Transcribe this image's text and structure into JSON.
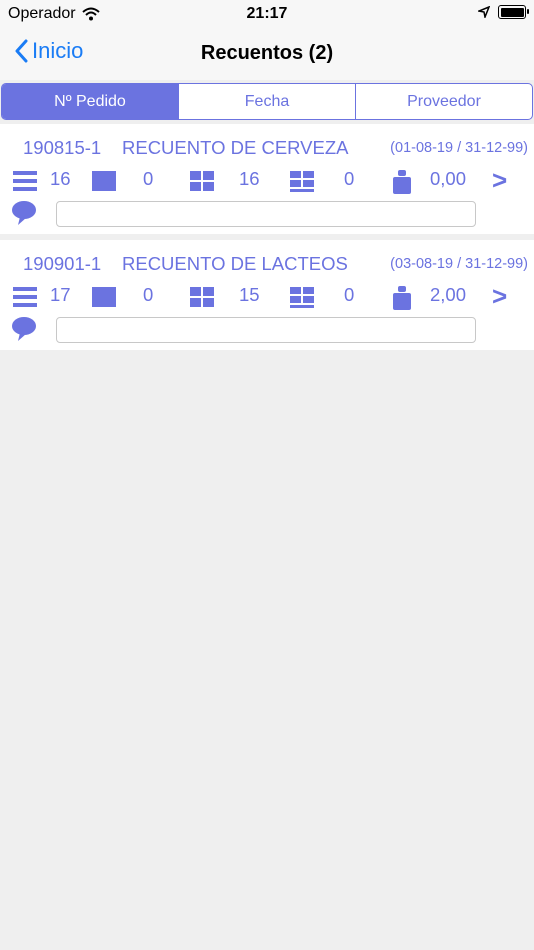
{
  "status_bar": {
    "carrier": "Operador",
    "time": "21:17"
  },
  "nav": {
    "back_label": "Inicio",
    "title": "Recuentos (2)"
  },
  "tabs": [
    {
      "label": "Nº Pedido",
      "active": true
    },
    {
      "label": "Fecha",
      "active": false
    },
    {
      "label": "Proveedor",
      "active": false
    }
  ],
  "icons": [
    "list-icon",
    "box-icon",
    "grid-icon",
    "pallet-icon",
    "weight-icon",
    "chevron-right-icon",
    "comment-icon",
    "wifi-icon",
    "location-arrow-icon",
    "battery-icon",
    "chevron-left-icon"
  ],
  "colors": {
    "accent": "#6b73e0",
    "link": "#1a7cf5"
  },
  "counts": [
    {
      "order": "190815-1",
      "name": "RECUENTO DE CERVEZA",
      "dates": "(01-08-19 / 31-12-99)",
      "lines": "16",
      "boxes": "0",
      "units": "16",
      "pallets": "0",
      "weight": "0,00",
      "comment": ""
    },
    {
      "order": "190901-1",
      "name": "RECUENTO DE LACTEOS",
      "dates": "(03-08-19 / 31-12-99)",
      "lines": "17",
      "boxes": "0",
      "units": "15",
      "pallets": "0",
      "weight": "2,00",
      "comment": ""
    }
  ]
}
